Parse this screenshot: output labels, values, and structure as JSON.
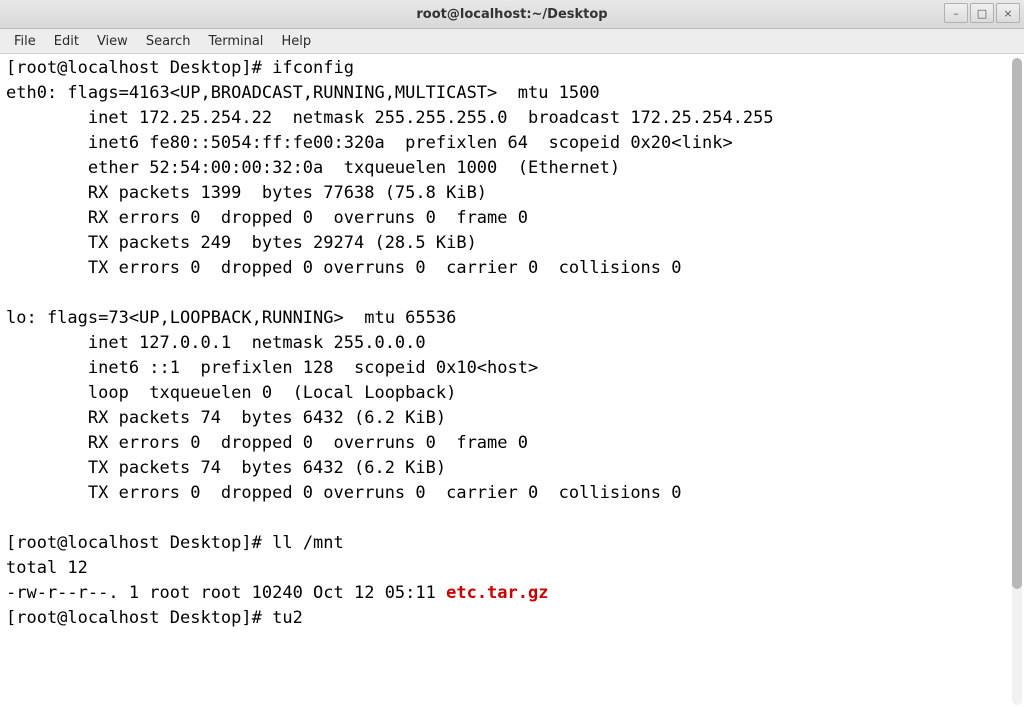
{
  "window": {
    "title": "root@localhost:~/Desktop"
  },
  "window_buttons": {
    "minimize": "–",
    "maximize": "□",
    "close": "×"
  },
  "menubar": {
    "file": "File",
    "edit": "Edit",
    "view": "View",
    "search": "Search",
    "terminal": "Terminal",
    "help": "Help"
  },
  "prompt": {
    "p1": "[root@localhost Desktop]# ",
    "cmd1": "ifconfig",
    "cmd2": "ll /mnt",
    "cmd3": "tu2"
  },
  "ifconfig": {
    "eth0_l1": "eth0: flags=4163<UP,BROADCAST,RUNNING,MULTICAST>  mtu 1500",
    "eth0_l2": "        inet 172.25.254.22  netmask 255.255.255.0  broadcast 172.25.254.255",
    "eth0_l3": "        inet6 fe80::5054:ff:fe00:320a  prefixlen 64  scopeid 0x20<link>",
    "eth0_l4": "        ether 52:54:00:00:32:0a  txqueuelen 1000  (Ethernet)",
    "eth0_l5": "        RX packets 1399  bytes 77638 (75.8 KiB)",
    "eth0_l6": "        RX errors 0  dropped 0  overruns 0  frame 0",
    "eth0_l7": "        TX packets 249  bytes 29274 (28.5 KiB)",
    "eth0_l8": "        TX errors 0  dropped 0 overruns 0  carrier 0  collisions 0",
    "lo_l1": "lo: flags=73<UP,LOOPBACK,RUNNING>  mtu 65536",
    "lo_l2": "        inet 127.0.0.1  netmask 255.0.0.0",
    "lo_l3": "        inet6 ::1  prefixlen 128  scopeid 0x10<host>",
    "lo_l4": "        loop  txqueuelen 0  (Local Loopback)",
    "lo_l5": "        RX packets 74  bytes 6432 (6.2 KiB)",
    "lo_l6": "        RX errors 0  dropped 0  overruns 0  frame 0",
    "lo_l7": "        TX packets 74  bytes 6432 (6.2 KiB)",
    "lo_l8": "        TX errors 0  dropped 0 overruns 0  carrier 0  collisions 0"
  },
  "ll": {
    "total": "total 12",
    "row_prefix": "-rw-r--r--. 1 root root 10240 Oct 12 05:11 ",
    "row_file": "etc.tar.gz"
  }
}
